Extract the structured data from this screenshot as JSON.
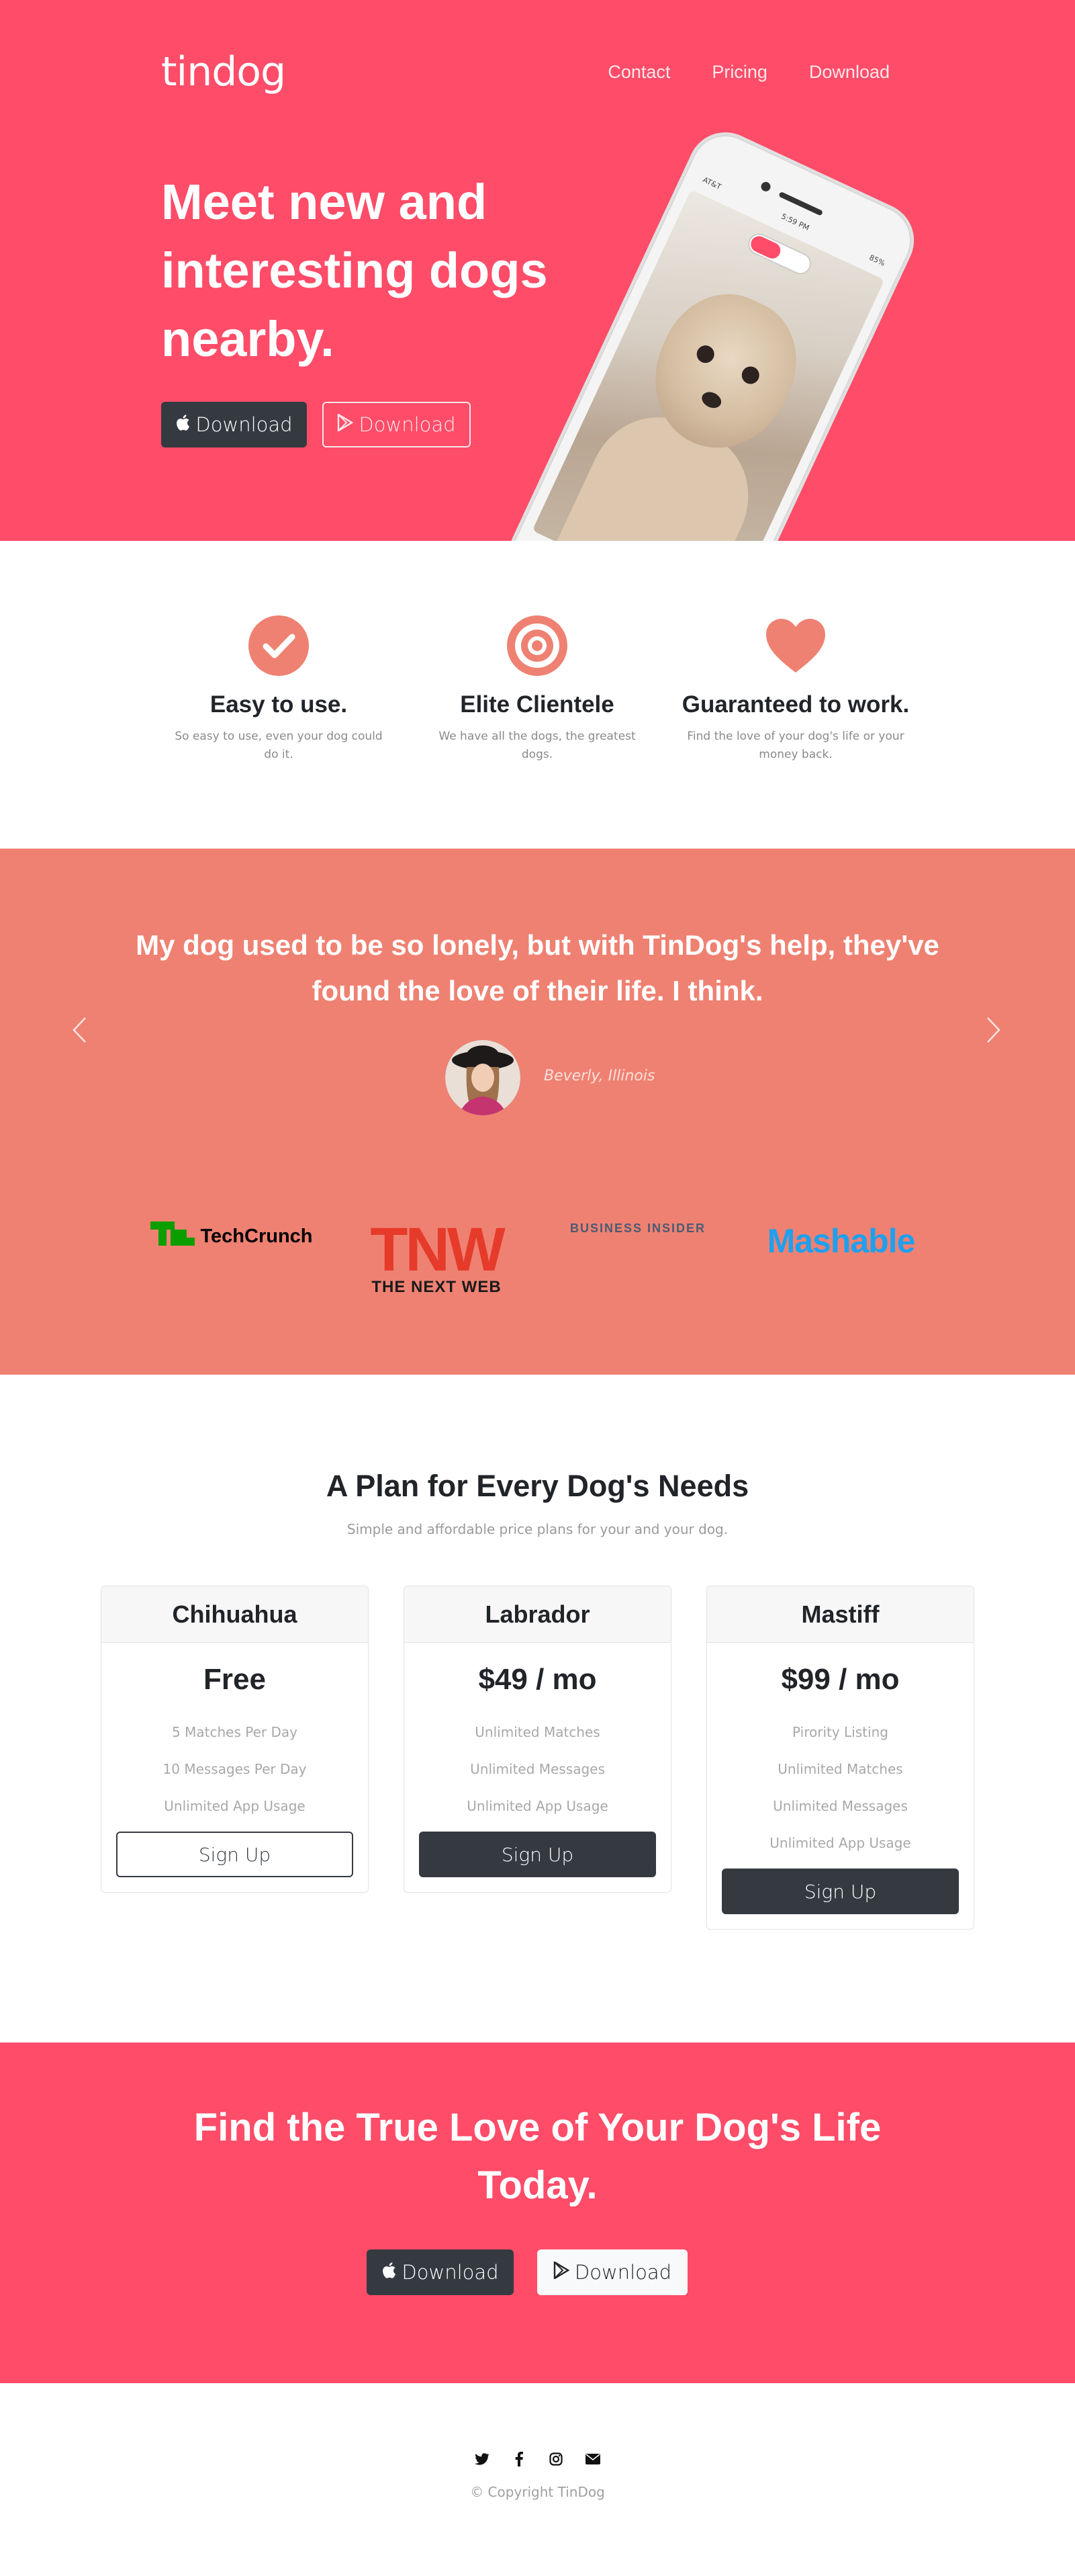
{
  "brand": "tindog",
  "nav": {
    "contact": "Contact",
    "pricing": "Pricing",
    "download": "Download"
  },
  "hero": {
    "title": "Meet new and interesting dogs nearby.",
    "apple_button": "Download",
    "google_button": "Download",
    "phone": {
      "carrier": "AT&T",
      "time": "5:59 PM",
      "battery": "85%"
    }
  },
  "features": [
    {
      "icon": "check-circle-icon",
      "title": "Easy to use.",
      "text": "So easy to use, even your dog could do it."
    },
    {
      "icon": "bullseye-icon",
      "title": "Elite Clientele",
      "text": "We have all the dogs, the greatest dogs."
    },
    {
      "icon": "heart-icon",
      "title": "Guaranteed to work.",
      "text": "Find the love of your dog's life or your money back."
    }
  ],
  "testimonial": {
    "quote": "My dog used to be so lonely, but with TinDog's help, they've found the love of their life. I think.",
    "author": "Beverly, Illinois"
  },
  "press": {
    "techcrunch": "TechCrunch",
    "tnw_big": "TNW",
    "tnw_small": "THE NEXT WEB",
    "business_insider": "BUSINESS INSIDER",
    "mashable": "Mashable"
  },
  "pricing": {
    "title": "A Plan for Every Dog's Needs",
    "subtitle": "Simple and affordable price plans for your and your dog.",
    "plans": [
      {
        "name": "Chihuahua",
        "price": "Free",
        "features": [
          "5 Matches Per Day",
          "10 Messages Per Day",
          "Unlimited App Usage"
        ],
        "button": "Sign Up"
      },
      {
        "name": "Labrador",
        "price": "$49 / mo",
        "features": [
          "Unlimited Matches",
          "Unlimited Messages",
          "Unlimited App Usage"
        ],
        "button": "Sign Up"
      },
      {
        "name": "Mastiff",
        "price": "$99 / mo",
        "features": [
          "Pirority Listing",
          "Unlimited Matches",
          "Unlimited Messages",
          "Unlimited App Usage"
        ],
        "button": "Sign Up"
      }
    ]
  },
  "cta": {
    "title": "Find the True Love of Your Dog's Life Today.",
    "apple_button": "Download",
    "google_button": "Download"
  },
  "footer": {
    "social_icons": [
      "twitter-icon",
      "facebook-icon",
      "instagram-icon",
      "envelope-icon"
    ],
    "copyright": "© Copyright TinDog"
  },
  "colors": {
    "primary_red": "#ff4c68",
    "testimonial_coral": "#ef8172",
    "dark": "#343a40"
  }
}
